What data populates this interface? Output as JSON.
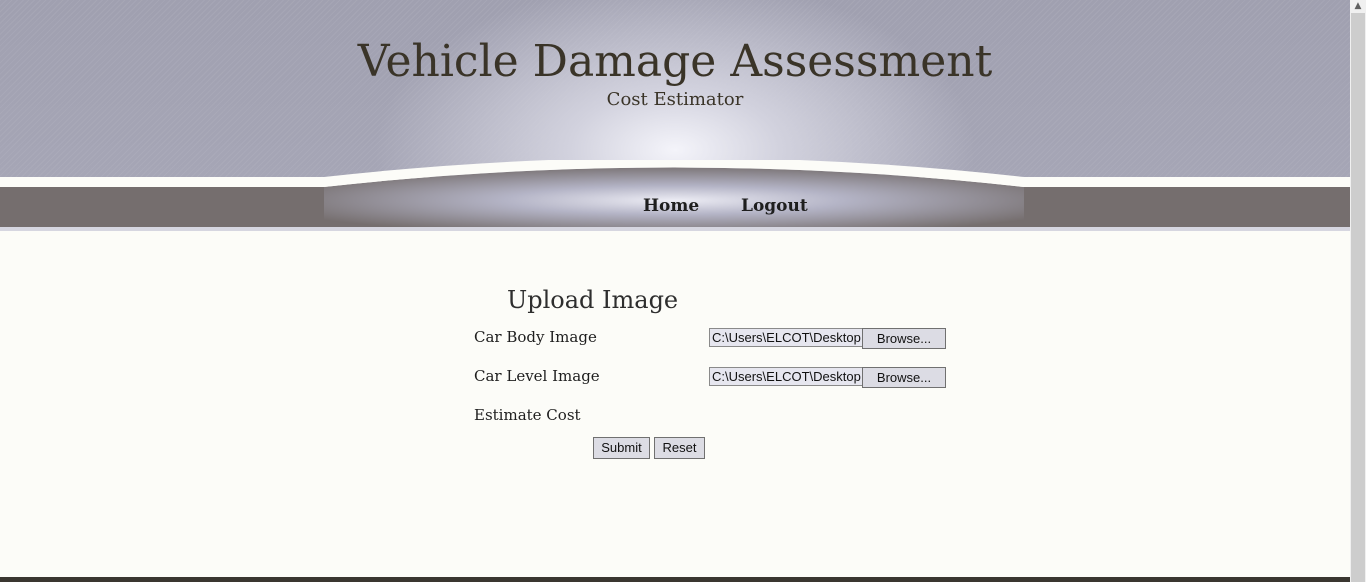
{
  "header": {
    "title": "Vehicle Damage Assessment",
    "subtitle": "Cost Estimator"
  },
  "nav": {
    "home": "Home",
    "logout": "Logout"
  },
  "form": {
    "title": "Upload Image",
    "car_body_label": "Car Body Image",
    "car_body_value": "C:\\Users\\ELCOT\\Desktop",
    "car_level_label": "Car Level Image",
    "car_level_value": "C:\\Users\\ELCOT\\Desktop",
    "browse_label": "Browse...",
    "estimate_label": "Estimate Cost",
    "submit_label": "Submit",
    "reset_label": "Reset"
  },
  "icons": {
    "scroll_up": "chevron-up-icon"
  },
  "colors": {
    "header_bg": "#a0a0b0",
    "nav_bg": "#756e6e",
    "page_bg": "#fcfcf8",
    "title_text": "#3a3428"
  }
}
